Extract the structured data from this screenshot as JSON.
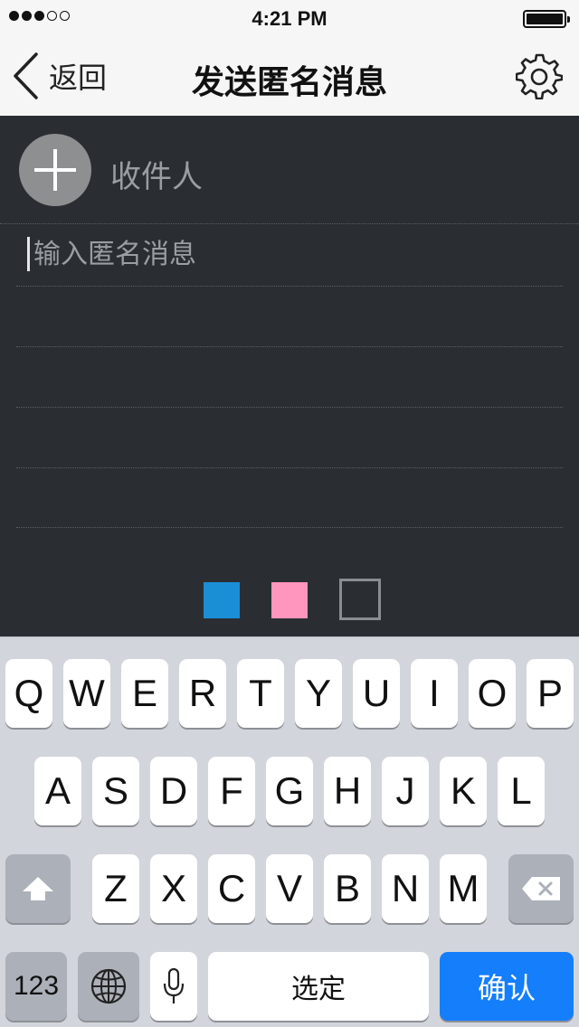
{
  "status_bar": {
    "time": "4:21 PM",
    "signal_filled": 3,
    "signal_total": 5,
    "battery_level": 1.0
  },
  "nav": {
    "back_label": "返回",
    "title": "发送匿名消息",
    "settings_icon": "gear-icon"
  },
  "compose": {
    "recipient_placeholder": "收件人",
    "message_placeholder": "输入匿名消息",
    "colors": [
      "#1a8fd6",
      "#ff96bd",
      "none"
    ]
  },
  "keyboard": {
    "row1": [
      "Q",
      "W",
      "E",
      "R",
      "T",
      "Y",
      "U",
      "I",
      "O",
      "P"
    ],
    "row2": [
      "A",
      "S",
      "D",
      "F",
      "G",
      "H",
      "J",
      "K",
      "L"
    ],
    "row3": [
      "Z",
      "X",
      "C",
      "V",
      "B",
      "N",
      "M"
    ],
    "numbers_label": "123",
    "space_label": "选定",
    "return_label": "确认",
    "return_color": "#147efb"
  }
}
